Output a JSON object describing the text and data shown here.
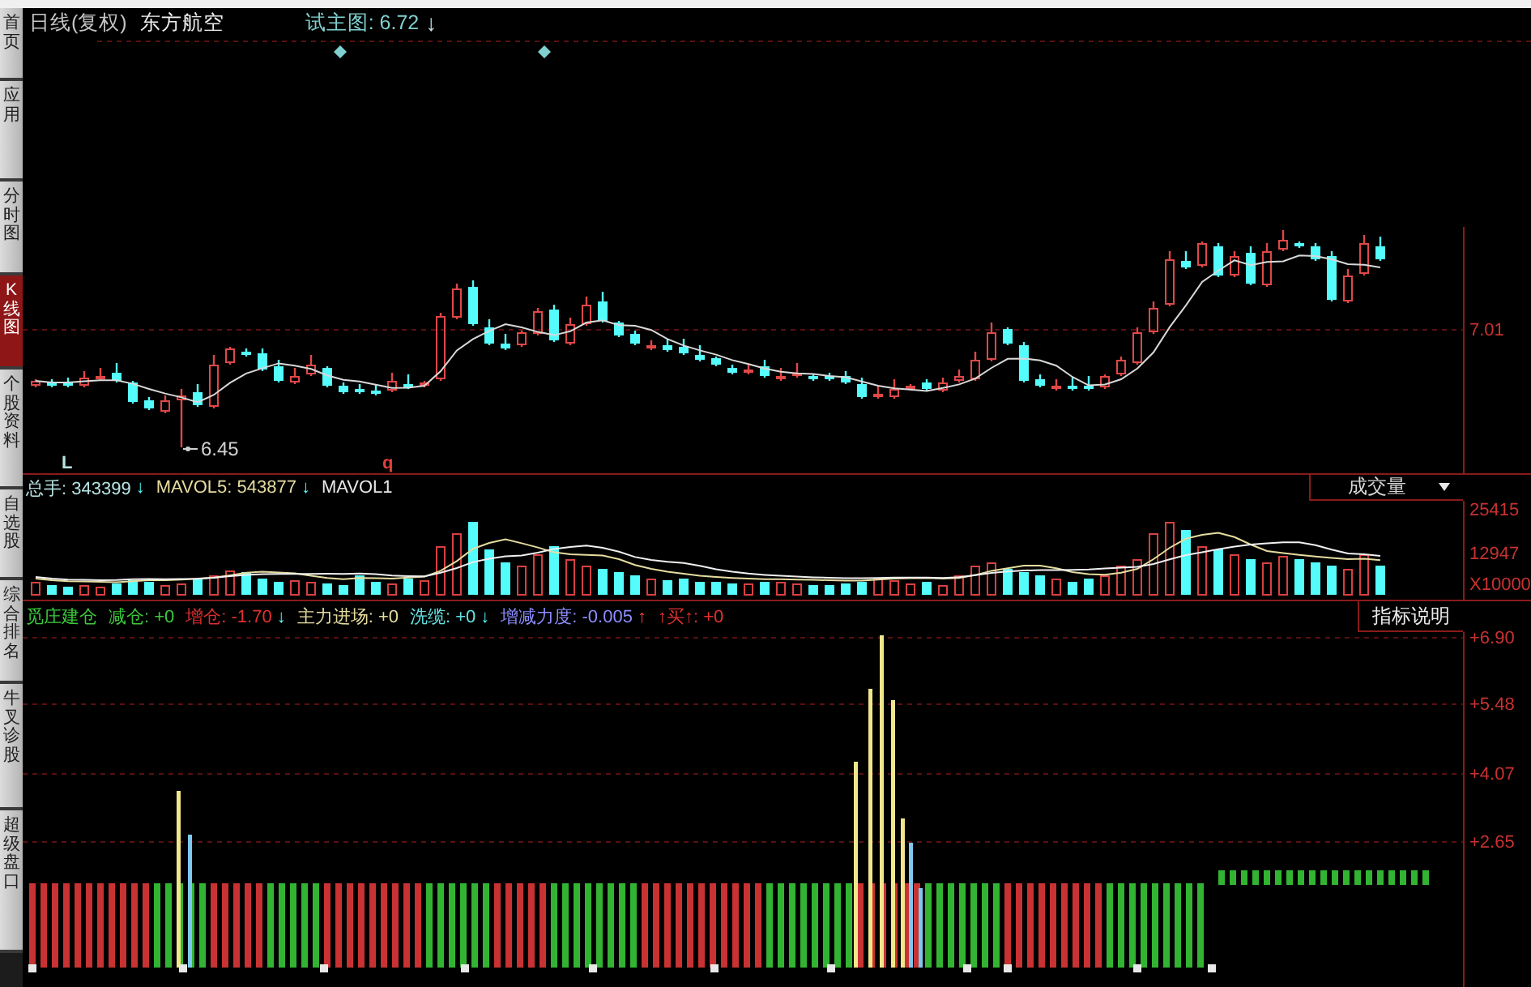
{
  "sidebar": {
    "tabs": [
      {
        "label": "首页",
        "selected": false
      },
      {
        "label": "应用",
        "selected": false
      },
      {
        "label": "分时图",
        "selected": false
      },
      {
        "label": "K线图",
        "selected": true
      },
      {
        "label": "个股资料",
        "selected": false
      },
      {
        "label": "自选股",
        "selected": false
      },
      {
        "label": "综合排名",
        "selected": false
      },
      {
        "label": "牛叉诊股",
        "selected": false
      },
      {
        "label": "超级盘口",
        "selected": false
      }
    ]
  },
  "header": {
    "period": "日线(复权)",
    "stock_name": "东方航空",
    "indicator": {
      "label": "试主图: 6.72",
      "arrow": {
        "symbol": "↓",
        "color": "#c0e0e0"
      }
    }
  },
  "price_panel": {
    "low_label": "6.45",
    "markers": [
      {
        "text": "L",
        "color": "#b8e4e4"
      },
      {
        "text": "q",
        "color": "#e04040"
      }
    ],
    "axis_labels": [
      "7.01"
    ]
  },
  "volume_panel": {
    "legend": [
      {
        "label": "总手: 343399",
        "color": "#b8e4e4",
        "arrow": {
          "symbol": "↓",
          "color": "#54fcfc"
        }
      },
      {
        "label": "MAVOL5: 543877",
        "color": "#e6dca0",
        "arrow": {
          "symbol": "↓",
          "color": "#54fcfc"
        }
      },
      {
        "label": "MAVOL1",
        "color": "#e8e8e8"
      }
    ],
    "selector": "成交量",
    "axis_labels": [
      "25415",
      "12947",
      "X10000"
    ]
  },
  "indicator_panel": {
    "title": "觅庄建仓",
    "legend": [
      {
        "label": "减仓: +0",
        "color": "#3cc83c"
      },
      {
        "label": "增仓: -1.70",
        "color": "#e03030",
        "arrow": {
          "symbol": "↓",
          "color": "#54fcfc"
        }
      },
      {
        "label": "主力进场: +0",
        "color": "#e6dca0"
      },
      {
        "label": "洗缆: +0",
        "color": "#66e0e0",
        "arrow": {
          "symbol": "↓",
          "color": "#54fcfc"
        }
      },
      {
        "label": "增减力度: -0.005",
        "color": "#8c8cff",
        "arrow": {
          "symbol": "↑",
          "color": "#ff4040"
        }
      },
      {
        "label": "↑买↑: +0",
        "color": "#e03030"
      }
    ],
    "help_button": "指标说明",
    "axis_labels": [
      "+6.90",
      "+5.48",
      "+4.07",
      "+2.65"
    ]
  }
}
